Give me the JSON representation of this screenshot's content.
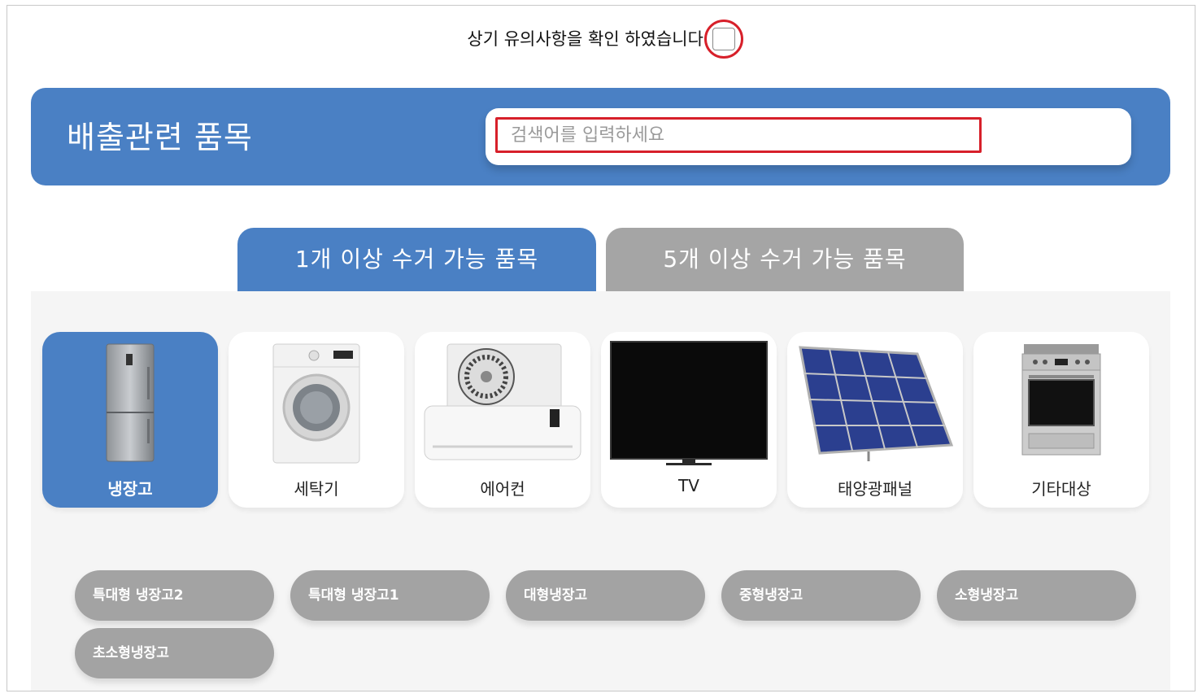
{
  "confirm": {
    "text": "상기 유의사항을 확인 하였습니다.",
    "checked": false
  },
  "banner": {
    "title": "배출관련 품목",
    "search_placeholder": "검색어를 입력하세요"
  },
  "tabs": [
    {
      "label": "1개 이상 수거 가능 품목",
      "active": true
    },
    {
      "label": "5개 이상 수거 가능 품목",
      "active": false
    }
  ],
  "categories": [
    {
      "label": "냉장고",
      "icon": "refrigerator-icon",
      "active": true
    },
    {
      "label": "세탁기",
      "icon": "washing-machine-icon",
      "active": false
    },
    {
      "label": "에어컨",
      "icon": "air-conditioner-icon",
      "active": false
    },
    {
      "label": "TV",
      "icon": "tv-icon",
      "active": false
    },
    {
      "label": "태양광패널",
      "icon": "solar-panel-icon",
      "active": false
    },
    {
      "label": "기타대상",
      "icon": "stove-icon",
      "active": false
    }
  ],
  "subitems": [
    "특대형 냉장고2",
    "특대형 냉장고1",
    "대형냉장고",
    "중형냉장고",
    "소형냉장고",
    "초소형냉장고"
  ],
  "colors": {
    "accent": "#4a80c4",
    "inactive": "#a5a5a5",
    "highlight": "#d7202a",
    "panel": "#f5f5f5"
  }
}
